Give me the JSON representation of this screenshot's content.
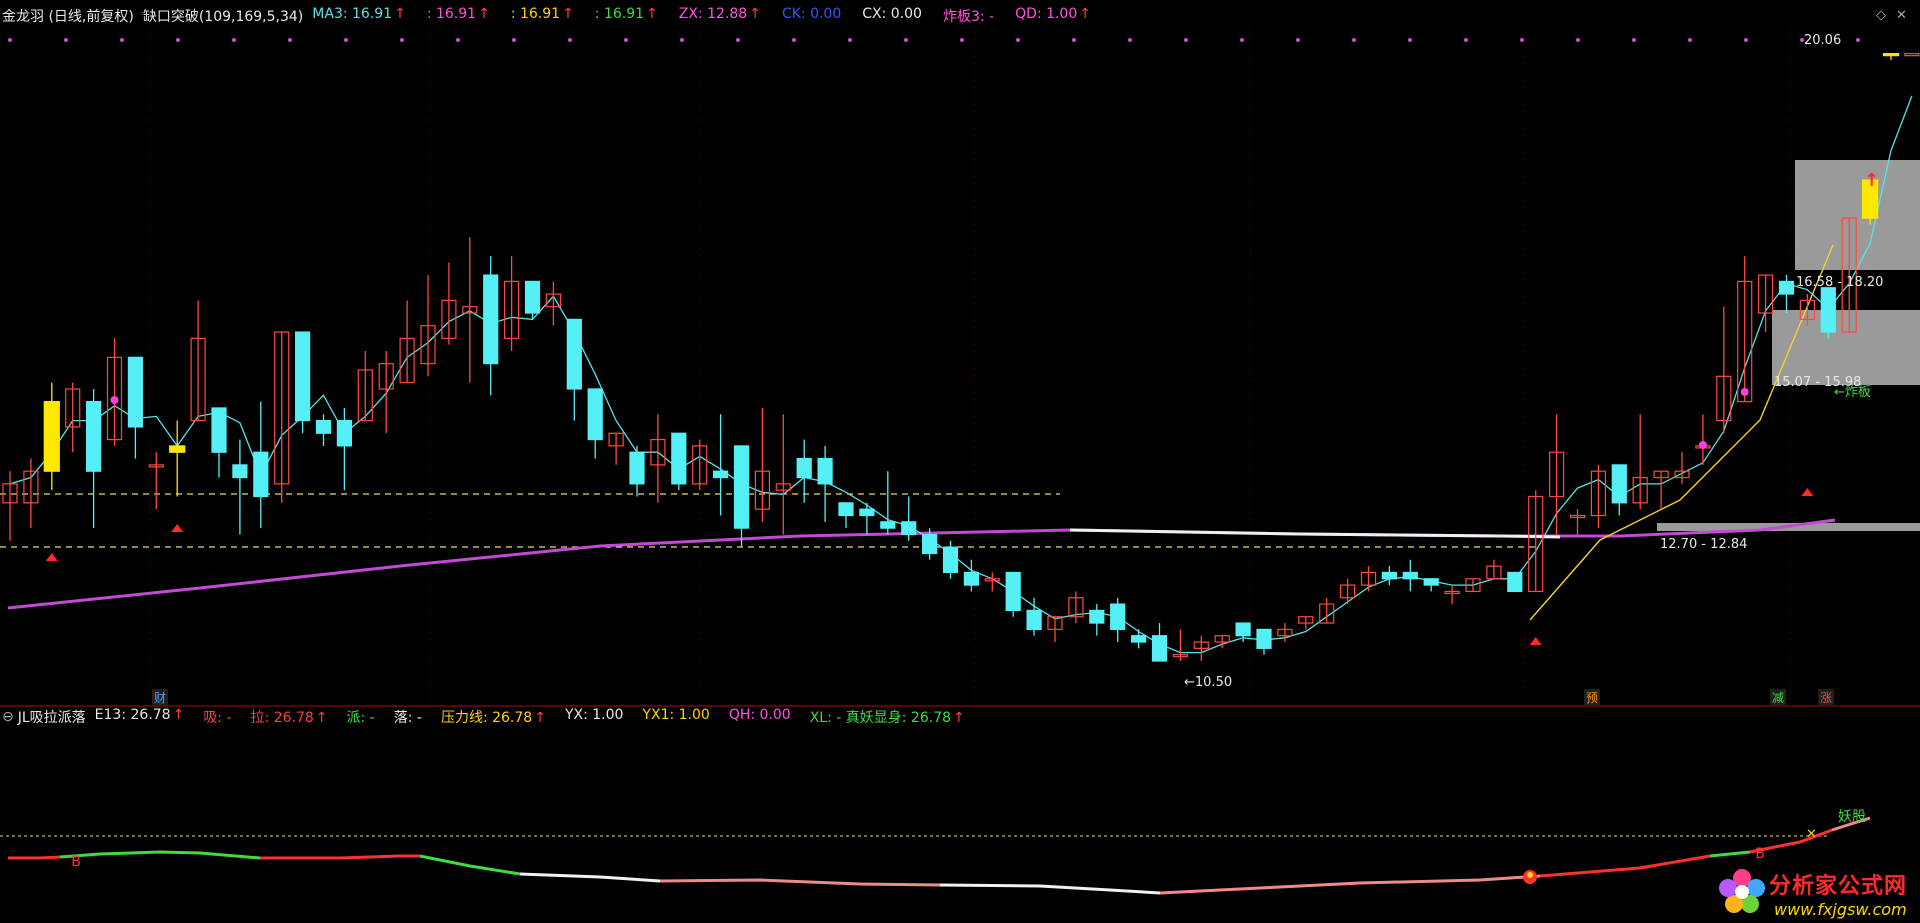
{
  "main_header": {
    "title": "金龙羽 (日线,前复权)",
    "indicator": "缺口突破(109,169,5,34)",
    "items": [
      {
        "label": "MA3: 16.91",
        "arrow": "↑",
        "color": "#57e3e8"
      },
      {
        "label": ": 16.91",
        "arrow": "↑",
        "color": "#ff4fd8"
      },
      {
        "label": ": 16.91",
        "arrow": "↑",
        "color": "#ffd400"
      },
      {
        "label": ": 16.91",
        "arrow": "↑",
        "color": "#3fdc3f"
      },
      {
        "label": "ZX: 12.88",
        "arrow": "↑",
        "color": "#ff55dd"
      },
      {
        "label": "CK: 0.00",
        "arrow": "",
        "color": "#3355ff"
      },
      {
        "label": "CX: 0.00",
        "arrow": "",
        "color": "#e8e8e8"
      },
      {
        "label": "炸板3: -",
        "arrow": "",
        "color": "#ff55dd"
      },
      {
        "label": "QD: 1.00",
        "arrow": "↑",
        "color": "#ff55dd"
      }
    ]
  },
  "sub_header": {
    "title": "JL吸拉派落",
    "items": [
      {
        "label": "E13: 26.78",
        "arrow": "↑",
        "color": "#e8e8e8"
      },
      {
        "label": "吸: -",
        "arrow": "",
        "color": "#ff4040"
      },
      {
        "label": "拉: 26.78",
        "arrow": "↑",
        "color": "#ff4040"
      },
      {
        "label": "派: -",
        "arrow": "",
        "color": "#3fdc3f"
      },
      {
        "label": "落: -",
        "arrow": "",
        "color": "#e8e8e8"
      },
      {
        "label": "压力线: 26.78",
        "arrow": "↑",
        "color": "#ffd400"
      },
      {
        "label": "YX: 1.00",
        "arrow": "",
        "color": "#e8e8e8"
      },
      {
        "label": "YX1: 1.00",
        "arrow": "",
        "color": "#ffd400"
      },
      {
        "label": "QH: 0.00",
        "arrow": "",
        "color": "#ff55dd"
      },
      {
        "label": "XL: - 真妖显身: 26.78",
        "arrow": "↑",
        "color": "#3fdc3f"
      }
    ]
  },
  "annotations": {
    "high_label": "20.06",
    "low_label": "←10.50",
    "zone_upper": "16.58 - 18.20",
    "zone_middle": "15.07 - 15.98",
    "zone_lower": "12.70 - 12.84",
    "zhaban_label": "←炸板",
    "yaogu_label": "妖股",
    "b_mark": "B",
    "event_markers": [
      {
        "text": "财",
        "color": "#4aa0ff"
      },
      {
        "text": "预",
        "color": "#ff8c1a"
      },
      {
        "text": "减",
        "color": "#3fdc3f"
      },
      {
        "text": "涨",
        "color": "#ff4040"
      }
    ]
  },
  "watermark": {
    "title": "分析家公式网",
    "url": "www.fxjgsw.com"
  },
  "colors": {
    "up": "#ff4a3d",
    "down": "#54f0f6",
    "yellow": "#ffe800",
    "ma": "#57e3e8",
    "trend": "#c34ad4",
    "dashed": "#e8d870"
  },
  "chart_data": {
    "type": "candlestick",
    "title": "金龙羽 (日线,前复权)",
    "candles": [
      [
        13.0,
        13.3,
        13.5,
        12.4
      ],
      [
        13.0,
        13.5,
        13.7,
        12.6
      ],
      [
        13.5,
        14.6,
        14.9,
        13.2
      ],
      [
        14.2,
        14.8,
        14.9,
        13.8
      ],
      [
        14.6,
        13.5,
        14.8,
        12.6
      ],
      [
        14.0,
        15.3,
        15.6,
        13.9
      ],
      [
        15.3,
        14.2,
        15.3,
        13.7
      ],
      [
        13.6,
        13.6,
        13.8,
        12.9
      ],
      [
        13.8,
        13.9,
        14.3,
        13.1
      ],
      [
        14.3,
        15.6,
        16.2,
        14.3
      ],
      [
        14.5,
        13.8,
        14.5,
        13.4
      ],
      [
        13.6,
        13.4,
        14.0,
        12.5
      ],
      [
        13.8,
        13.1,
        14.6,
        12.6
      ],
      [
        13.3,
        15.7,
        15.7,
        13.0
      ],
      [
        15.7,
        14.3,
        15.7,
        14.1
      ],
      [
        14.3,
        14.1,
        14.4,
        13.9
      ],
      [
        14.3,
        13.9,
        14.5,
        13.2
      ],
      [
        14.3,
        15.1,
        15.4,
        14.3
      ],
      [
        14.8,
        15.2,
        15.4,
        14.1
      ],
      [
        14.9,
        15.6,
        16.2,
        14.9
      ],
      [
        15.2,
        15.8,
        16.6,
        15.0
      ],
      [
        15.6,
        16.2,
        16.8,
        15.5
      ],
      [
        16.0,
        16.1,
        17.2,
        14.9
      ],
      [
        16.6,
        15.2,
        16.9,
        14.7
      ],
      [
        15.6,
        16.5,
        16.9,
        15.4
      ],
      [
        16.5,
        16.0,
        16.5,
        15.9
      ],
      [
        16.1,
        16.3,
        16.5,
        15.8
      ],
      [
        15.9,
        14.8,
        15.9,
        14.3
      ],
      [
        14.8,
        14.0,
        14.8,
        13.7
      ],
      [
        13.9,
        14.1,
        14.1,
        13.6
      ],
      [
        13.8,
        13.3,
        13.9,
        13.1
      ],
      [
        13.6,
        14.0,
        14.4,
        13.0
      ],
      [
        14.1,
        13.3,
        14.1,
        13.2
      ],
      [
        13.3,
        13.9,
        14.0,
        13.2
      ],
      [
        13.5,
        13.4,
        14.4,
        12.8
      ],
      [
        13.9,
        12.6,
        13.9,
        12.3
      ],
      [
        12.9,
        13.5,
        14.5,
        12.7
      ],
      [
        13.2,
        13.3,
        14.4,
        12.5
      ],
      [
        13.7,
        13.4,
        14.0,
        13.0
      ],
      [
        13.7,
        13.3,
        13.9,
        12.7
      ],
      [
        13.0,
        12.8,
        13.0,
        12.6
      ],
      [
        12.9,
        12.8,
        13.0,
        12.5
      ],
      [
        12.7,
        12.6,
        13.5,
        12.5
      ],
      [
        12.7,
        12.5,
        13.1,
        12.4
      ],
      [
        12.5,
        12.2,
        12.6,
        12.1
      ],
      [
        12.3,
        11.9,
        12.4,
        11.8
      ],
      [
        11.9,
        11.7,
        12.1,
        11.6
      ],
      [
        11.8,
        11.8,
        11.9,
        11.6
      ],
      [
        11.9,
        11.3,
        11.9,
        11.2
      ],
      [
        11.3,
        11.0,
        11.5,
        10.9
      ],
      [
        11.0,
        11.2,
        11.2,
        10.8
      ],
      [
        11.2,
        11.5,
        11.6,
        11.1
      ],
      [
        11.3,
        11.1,
        11.4,
        10.9
      ],
      [
        11.4,
        11.0,
        11.5,
        10.8
      ],
      [
        10.9,
        10.8,
        11.0,
        10.7
      ],
      [
        10.9,
        10.5,
        11.1,
        10.5
      ],
      [
        10.6,
        10.6,
        11.0,
        10.5
      ],
      [
        10.7,
        10.8,
        10.9,
        10.5
      ],
      [
        10.8,
        10.9,
        10.9,
        10.7
      ],
      [
        11.1,
        10.9,
        11.1,
        10.8
      ],
      [
        11.0,
        10.7,
        11.0,
        10.6
      ],
      [
        10.9,
        11.0,
        11.1,
        10.8
      ],
      [
        11.1,
        11.2,
        11.2,
        11.0
      ],
      [
        11.1,
        11.4,
        11.5,
        11.1
      ],
      [
        11.5,
        11.7,
        11.8,
        11.4
      ],
      [
        11.7,
        11.9,
        12.0,
        11.6
      ],
      [
        11.9,
        11.8,
        12.0,
        11.7
      ],
      [
        11.9,
        11.8,
        12.1,
        11.6
      ],
      [
        11.8,
        11.7,
        11.8,
        11.6
      ],
      [
        11.6,
        11.6,
        11.7,
        11.4
      ],
      [
        11.6,
        11.8,
        11.8,
        11.6
      ],
      [
        11.8,
        12.0,
        12.1,
        11.8
      ],
      [
        11.9,
        11.6,
        11.9,
        11.6
      ],
      [
        11.6,
        13.1,
        13.2,
        11.6
      ],
      [
        13.1,
        13.8,
        14.4,
        12.5
      ],
      [
        12.8,
        12.8,
        12.9,
        12.5
      ],
      [
        12.8,
        13.5,
        13.6,
        12.6
      ],
      [
        13.6,
        13.0,
        13.6,
        12.8
      ],
      [
        13.0,
        13.4,
        14.4,
        12.9
      ],
      [
        13.4,
        13.5,
        13.5,
        12.9
      ],
      [
        13.4,
        13.5,
        13.8,
        13.3
      ],
      [
        13.9,
        13.9,
        14.4,
        13.6
      ],
      [
        14.3,
        15.0,
        16.1,
        14.1
      ],
      [
        14.6,
        16.5,
        16.9,
        14.6
      ],
      [
        16.0,
        16.6,
        16.6,
        15.7
      ],
      [
        16.5,
        16.3,
        16.6,
        16.0
      ],
      [
        15.9,
        16.2,
        16.3,
        15.8
      ],
      [
        16.4,
        15.7,
        16.4,
        15.6
      ],
      [
        15.7,
        17.5,
        17.5,
        15.7
      ],
      [
        17.5,
        18.1,
        18.1,
        17.4
      ],
      [
        20.1,
        20.1,
        20.1,
        20.0
      ],
      [
        20.1,
        20.1,
        20.1,
        20.1
      ]
    ],
    "price_labels": {
      "high": 20.06,
      "low": 10.5
    },
    "sub_indicator": "JL吸拉派落"
  }
}
